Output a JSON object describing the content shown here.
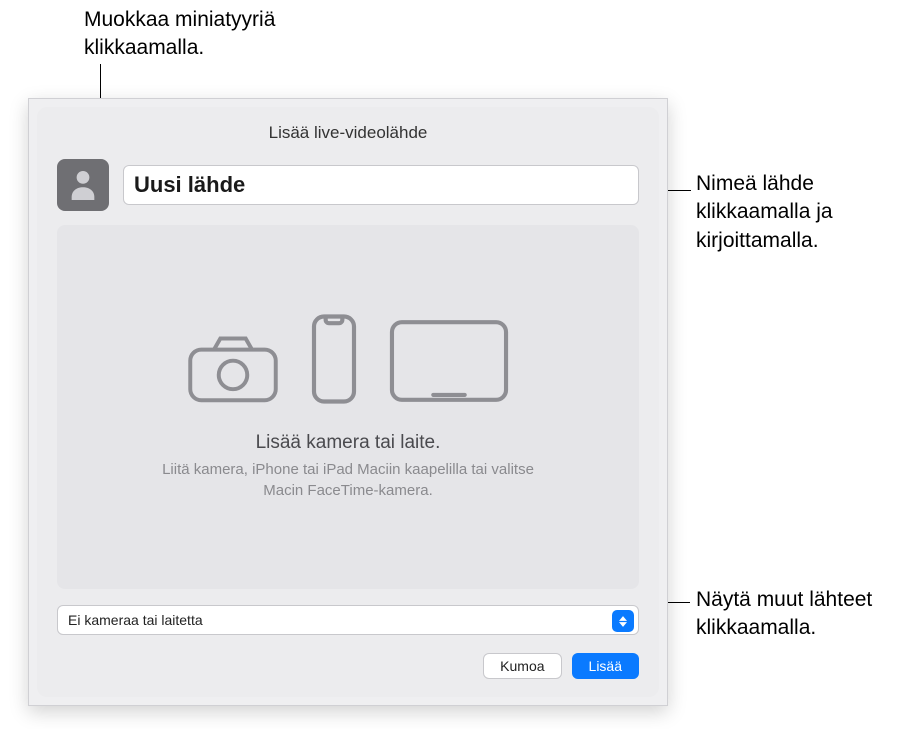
{
  "callouts": {
    "thumbnail": "Muokkaa miniatyyriä klikkaamalla.",
    "name": "Nimeä lähde klikkaamalla ja kirjoittamalla.",
    "other": "Näytä muut lähteet klikkaamalla."
  },
  "dialog": {
    "title": "Lisää live-videolähde",
    "name_value": "Uusi lähde",
    "preview": {
      "title": "Lisää kamera tai laite.",
      "subtitle": "Liitä kamera, iPhone tai iPad Maciin kaapelilla tai valitse Macin FaceTime-kamera."
    },
    "select": {
      "value": "Ei kameraa tai laitetta"
    },
    "buttons": {
      "cancel": "Kumoa",
      "add": "Lisää"
    }
  },
  "icons": {
    "thumbnail": "person-silhouette-icon",
    "camera": "camera-icon",
    "phone": "phone-icon",
    "tablet": "tablet-icon",
    "select_arrows": "updown-arrows-icon"
  }
}
